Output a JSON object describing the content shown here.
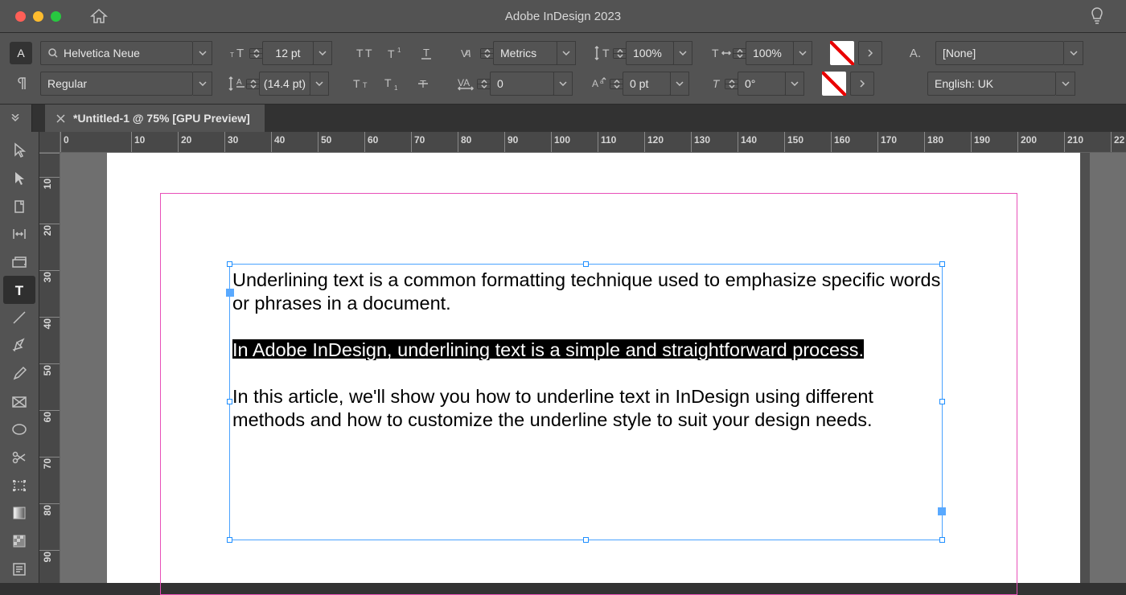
{
  "app": {
    "title": "Adobe InDesign 2023"
  },
  "tab": {
    "label": "*Untitled-1 @ 75% [GPU Preview]"
  },
  "controls": {
    "font_family": "Helvetica Neue",
    "font_style": "Regular",
    "font_size": "12 pt",
    "leading": "(14.4 pt)",
    "kerning": "Metrics",
    "tracking": "0",
    "vscale": "100%",
    "hscale": "100%",
    "baseline": "0 pt",
    "skew": "0°",
    "char_style": "[None]",
    "language": "English: UK"
  },
  "ruler": {
    "h": [
      "0",
      "10",
      "20",
      "30",
      "40",
      "50",
      "60",
      "70",
      "80",
      "90",
      "100",
      "110",
      "120",
      "130",
      "140",
      "150",
      "160",
      "170",
      "180",
      "190",
      "200",
      "210",
      "22"
    ],
    "v": [
      "",
      "10",
      "20",
      "30",
      "40",
      "50",
      "60",
      "70",
      "80",
      "90"
    ]
  },
  "document": {
    "p1": "Underlining text is a common formatting technique used to emphasize specific words or phrases in a document.",
    "p2": "In Adobe InDesign, underlining text is a simple and straightforward process. ",
    "p3": "In this article, we'll show you how to underline text in InDesign using different methods and how to customize the underline style to suit your design needs."
  }
}
